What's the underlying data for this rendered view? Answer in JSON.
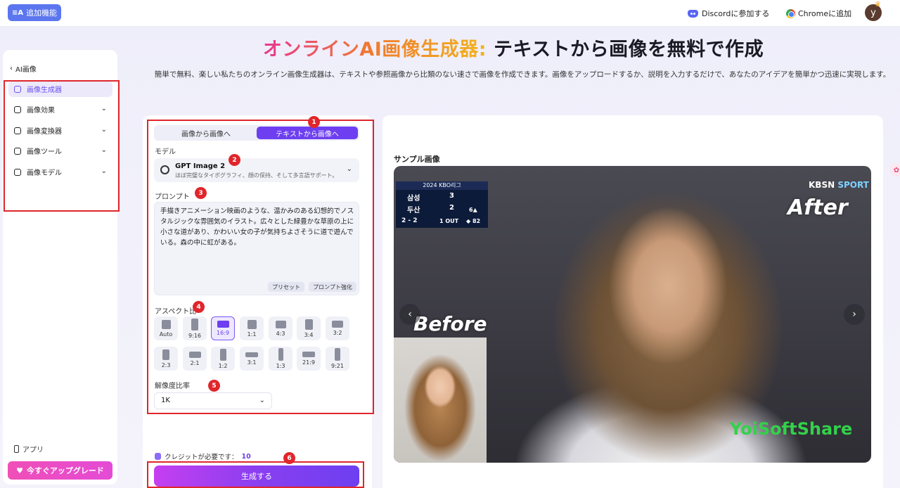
{
  "topbar": {
    "feature_label": "追加機能",
    "feature_icon": "sparkle-icon",
    "discord_label": "Discordに参加する",
    "chrome_label": "Chromeに追加",
    "avatar_letter": "y"
  },
  "sidebar": {
    "back_label": "AI画像",
    "items": [
      {
        "label": "画像生成器",
        "icon": "image-generator-icon",
        "active": true
      },
      {
        "label": "画像効果",
        "icon": "effects-icon"
      },
      {
        "label": "画像変換器",
        "icon": "converter-icon"
      },
      {
        "label": "画像ツール",
        "icon": "toolbox-icon"
      },
      {
        "label": "画像モデル",
        "icon": "model-icon"
      }
    ],
    "app_label": "アプリ",
    "upgrade_label": "今すぐアップグレード"
  },
  "hero": {
    "title_highlight": "オンラインAI画像生成器:",
    "title_rest": " テキストから画像を無料で作成",
    "description": "簡単で無料、楽しい私たちのオンライン画像生成器は、テキストや参照画像から比類のない速さで画像を作成できます。画像をアップロードするか、説明を入力するだけで、あなたのアイデアを簡単かつ迅速に実現します。"
  },
  "form": {
    "tabs": [
      {
        "label": "画像から画像へ",
        "active": false
      },
      {
        "label": "テキストから画像へ",
        "active": true
      }
    ],
    "model_label": "モデル",
    "model_name": "GPT Image 2",
    "model_desc": "ほぼ完璧なタイポグラフィ、顔の保持、そして多言語サポート。",
    "prompt_label": "プロンプト",
    "prompt_text": "手描きアニメーション映画のような、温かみのある幻想的でノスタルジックな雰囲気のイラスト。広々とした緑豊かな草原の上に小さな道があり、かわいい女の子が気持ちよさそうに道で遊んでいる。森の中に虹がある。",
    "preset_label": "プリセット",
    "enhance_label": "プロンプト強化",
    "aspect_label": "アスペクト比",
    "aspect_ratios": [
      "Auto",
      "9:16",
      "16:9",
      "1:1",
      "4:3",
      "3:4",
      "3:2",
      "2:3",
      "2:1",
      "1:2",
      "3:1",
      "1:3",
      "21:9",
      "9:21"
    ],
    "aspect_selected": "16:9",
    "resolution_label": "解像度比率",
    "resolution_value": "1K",
    "credit_label": "クレジットが必要です：",
    "credit_value": "10",
    "generate_label": "生成する"
  },
  "sample": {
    "title": "サンプル画像",
    "before_label": "Before",
    "after_label": "After",
    "broadcaster_a": "KBSN",
    "broadcaster_b": "SPORT",
    "watermark": "YoiSoftShare",
    "scoreboard": {
      "header": "2024 KBO리그",
      "team1": "삼성",
      "score1": "3",
      "team2": "두산",
      "score2": "2",
      "count": "2 - 2",
      "outs": "1 OUT",
      "inning": "6▲",
      "pitches": "◆ 82"
    }
  },
  "annotations": [
    "1",
    "2",
    "3",
    "4",
    "5",
    "6"
  ],
  "colors": {
    "accent": "#6d3ff0",
    "annotation": "#e0262b",
    "feature_button": "#5b76ee"
  }
}
